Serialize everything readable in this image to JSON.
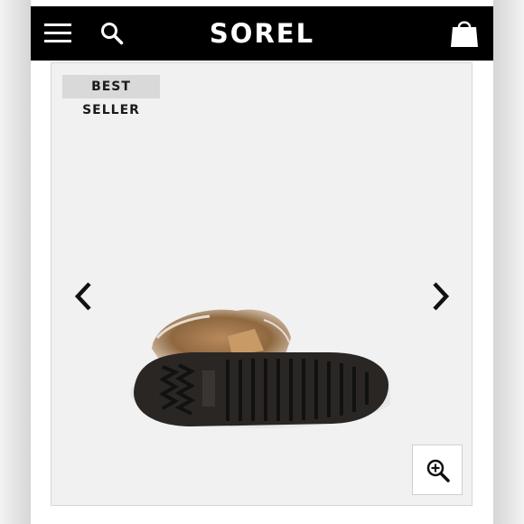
{
  "header": {
    "logo_text": "SOREL",
    "menu_icon": "hamburger-menu-icon",
    "search_icon": "search-icon",
    "cart_icon": "shopping-bag-icon",
    "background_color": "#000000",
    "foreground_color": "#ffffff"
  },
  "gallery": {
    "badge_label": "BEST SELLER",
    "prev_icon": "chevron-left-icon",
    "next_icon": "chevron-right-icon",
    "zoom_icon": "zoom-in-icon",
    "background_color": "#f1f1f1",
    "badge_color": "#d9d9d9"
  }
}
